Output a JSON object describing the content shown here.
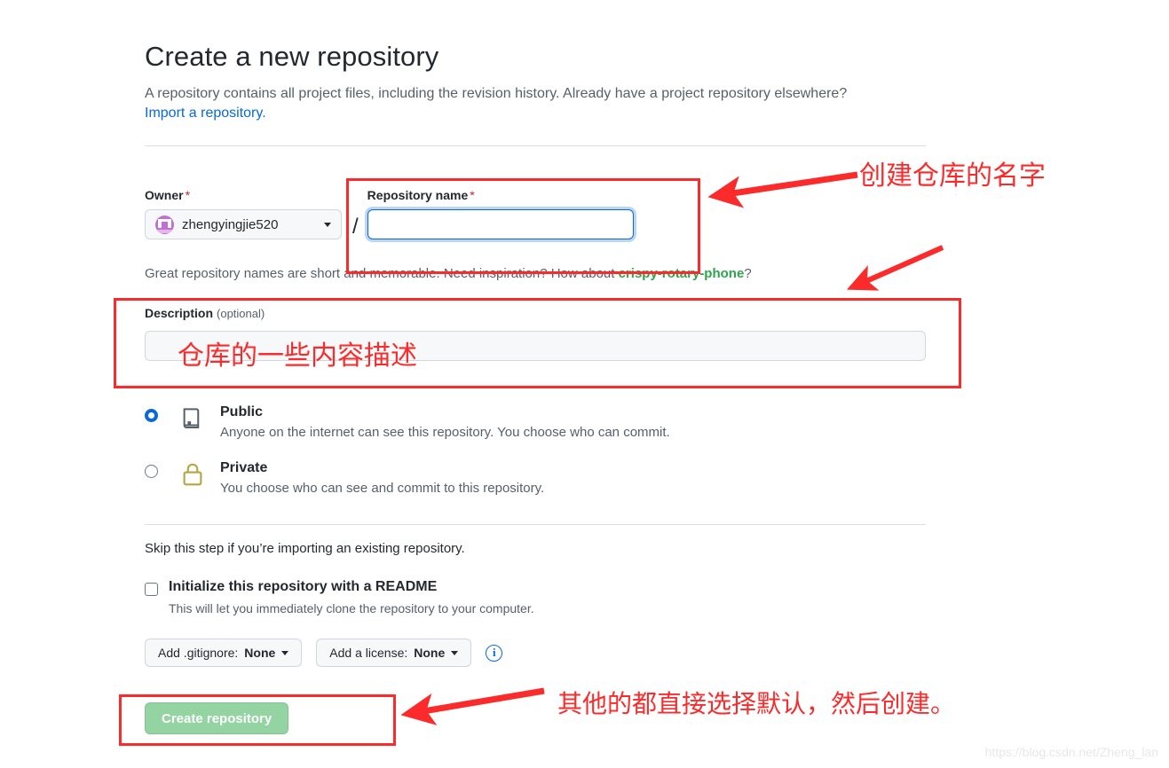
{
  "header": {
    "title": "Create a new repository",
    "subtitle": "A repository contains all project files, including the revision history. Already have a project repository elsewhere?",
    "import_link": "Import a repository."
  },
  "owner": {
    "label": "Owner",
    "required_mark": "*",
    "name": "zhengyingjie520",
    "avatar_icon": "user-avatar-identicon",
    "caret_icon": "chevron-down-icon",
    "separator": "/"
  },
  "repository_name": {
    "label": "Repository name",
    "required_mark": "*",
    "value": "",
    "placeholder": ""
  },
  "hint": {
    "prefix": "Great repository names are short and memorable. Need inspiration? How about ",
    "suggestion": "crispy-rotary-phone",
    "suffix": "?"
  },
  "description": {
    "label": "Description",
    "optional": "(optional)",
    "value": "",
    "placeholder": ""
  },
  "visibility": {
    "options": [
      {
        "id": "public",
        "title": "Public",
        "description": "Anyone on the internet can see this repository. You choose who can commit.",
        "icon": "repo-book-icon",
        "selected": true
      },
      {
        "id": "private",
        "title": "Private",
        "description": "You choose who can see and commit to this repository.",
        "icon": "lock-icon",
        "selected": false
      }
    ]
  },
  "initialize": {
    "skip_text": "Skip this step if you’re importing an existing repository.",
    "readme_label": "Initialize this repository with a README",
    "readme_description": "This will let you immediately clone the repository to your computer.",
    "readme_checked": false,
    "gitignore_button": "Add .gitignore: ",
    "gitignore_value": "None",
    "license_button": "Add a license: ",
    "license_value": "None",
    "info_icon": "info-icon",
    "caret_icon": "chevron-down-icon"
  },
  "submit": {
    "label": "Create repository",
    "disabled": true,
    "color": "#94d3a2"
  },
  "annotations": {
    "color": "#fb2b2b",
    "repo_name_note": "创建仓库的名字",
    "description_note": "仓库的一些内容描述",
    "create_note": "其他的都直接选择默认，然后创建。"
  },
  "watermark": "https://blog.csdn.net/Zheng_lan"
}
